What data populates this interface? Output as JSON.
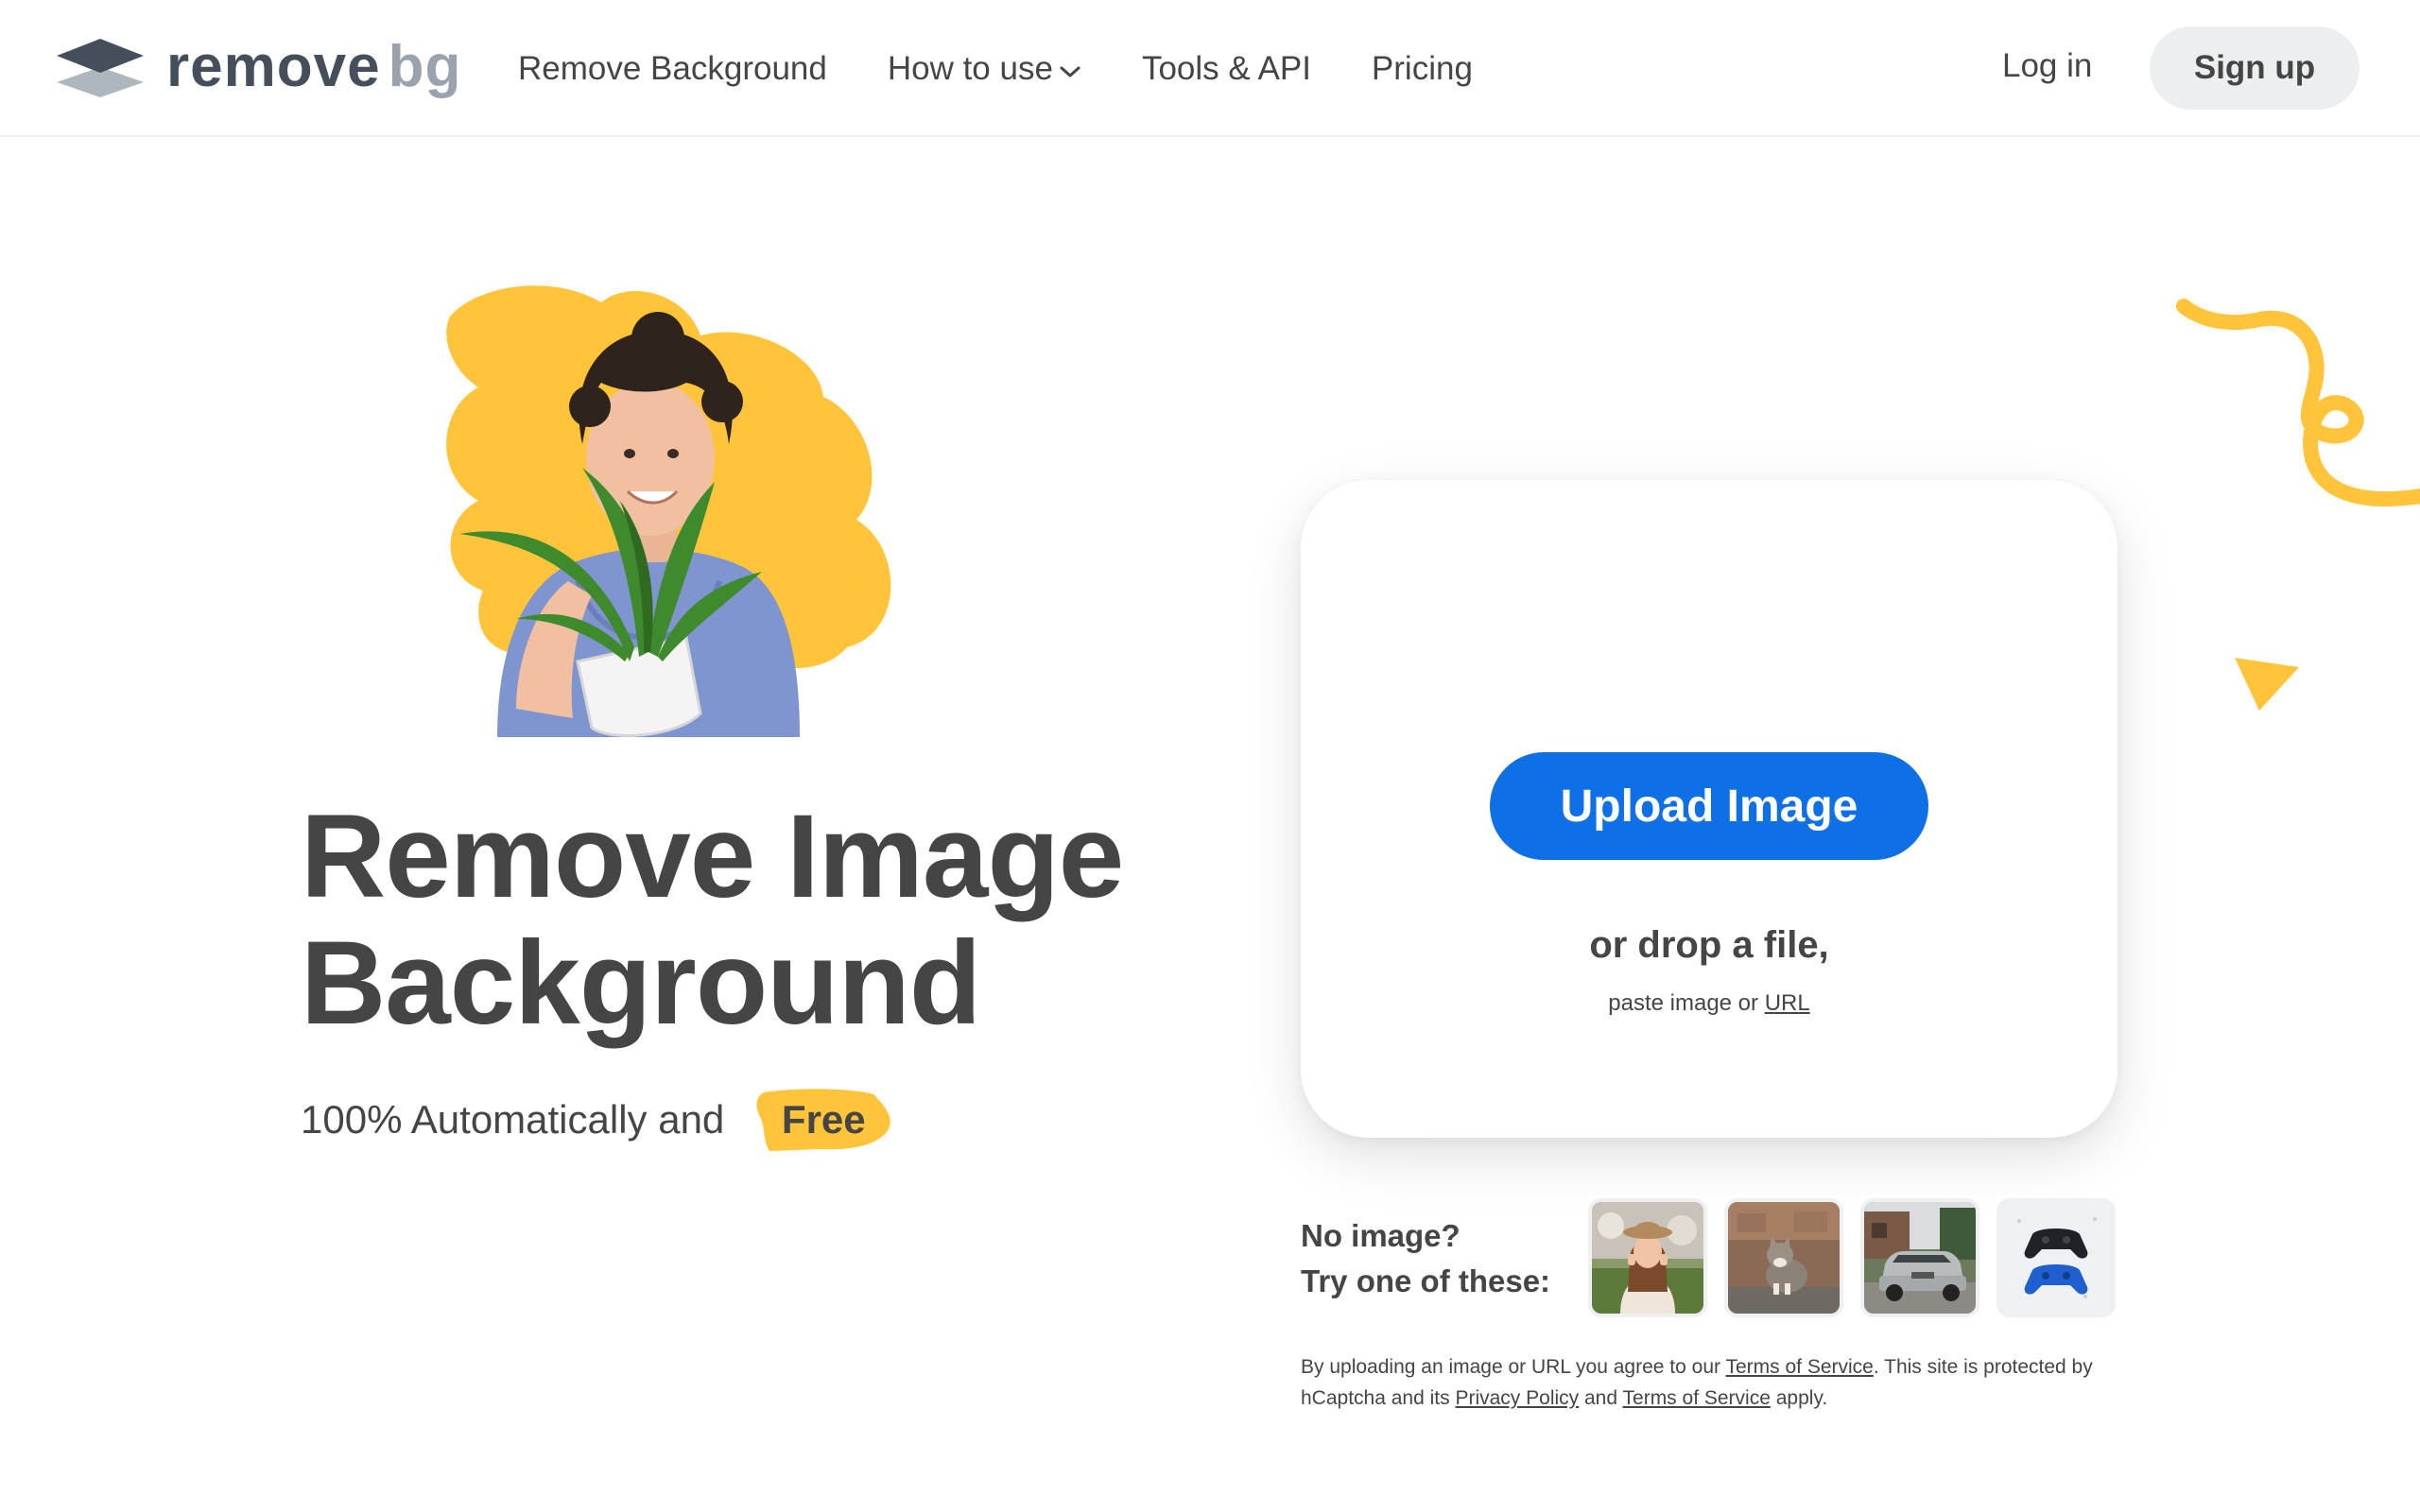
{
  "brand": {
    "logo_word_a": "remove",
    "logo_word_b": "bg"
  },
  "nav": {
    "items": [
      {
        "label": "Remove Background"
      },
      {
        "label": "How to use",
        "has_dropdown": true
      },
      {
        "label": "Tools & API"
      },
      {
        "label": "Pricing"
      }
    ],
    "login_label": "Log in",
    "signup_label": "Sign up"
  },
  "hero": {
    "title_line_1": "Remove Image",
    "title_line_2": "Background",
    "subtitle": "100% Automatically and",
    "badge": "Free"
  },
  "upload": {
    "button_label": "Upload Image",
    "drop_text": "or drop a file,",
    "paste_prefix": "paste image or",
    "url_link": "URL"
  },
  "samples": {
    "label_line_1": "No image?",
    "label_line_2": "Try one of these:",
    "items": [
      {
        "icon": "woman-photo"
      },
      {
        "icon": "cat-photo"
      },
      {
        "icon": "car-photo"
      },
      {
        "icon": "gamepads-photo"
      }
    ]
  },
  "legal": {
    "part_1": "By uploading an image or URL you agree to our",
    "tos_link_1": "Terms of Service",
    "part_2": ". This site is protected by hCaptcha and its",
    "privacy_link": "Privacy Policy",
    "part_3": "and",
    "tos_link_2": "Terms of Service",
    "part_4": "apply."
  },
  "colors": {
    "primary": "#0f70e6",
    "accent_yellow": "#ffc43a",
    "text": "#454545",
    "signup_bg": "#eceef0"
  }
}
